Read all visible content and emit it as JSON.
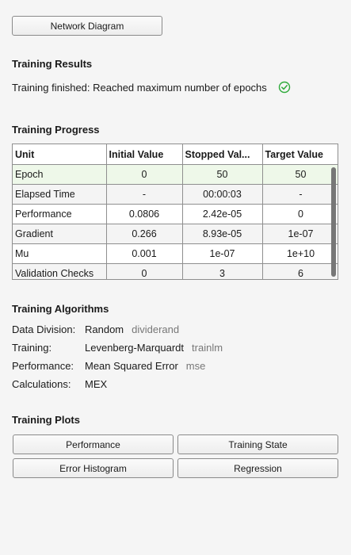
{
  "network_diagram_button": "Network Diagram",
  "results": {
    "heading": "Training Results",
    "status": "Training finished: Reached maximum number of epochs"
  },
  "progress": {
    "heading": "Training Progress",
    "columns": [
      "Unit",
      "Initial Value",
      "Stopped Val...",
      "Target Value"
    ],
    "rows": [
      [
        "Epoch",
        "0",
        "50",
        "50"
      ],
      [
        "Elapsed Time",
        "-",
        "00:00:03",
        "-"
      ],
      [
        "Performance",
        "0.0806",
        "2.42e-05",
        "0"
      ],
      [
        "Gradient",
        "0.266",
        "8.93e-05",
        "1e-07"
      ],
      [
        "Mu",
        "0.001",
        "1e-07",
        "1e+10"
      ],
      [
        "Validation Checks",
        "0",
        "3",
        "6"
      ]
    ]
  },
  "algorithms": {
    "heading": "Training Algorithms",
    "items": [
      {
        "label": "Data Division:",
        "value": "Random",
        "code": "dividerand"
      },
      {
        "label": "Training:",
        "value": "Levenberg-Marquardt",
        "code": "trainlm"
      },
      {
        "label": "Performance:",
        "value": "Mean Squared Error",
        "code": "mse"
      },
      {
        "label": "Calculations:",
        "value": "MEX",
        "code": ""
      }
    ]
  },
  "plots": {
    "heading": "Training Plots",
    "buttons": [
      "Performance",
      "Training State",
      "Error Histogram",
      "Regression"
    ]
  },
  "colors": {
    "success": "#2eaa3a",
    "selected_row": "#eef8e9"
  },
  "icons": {
    "status": "check-circle-icon"
  }
}
